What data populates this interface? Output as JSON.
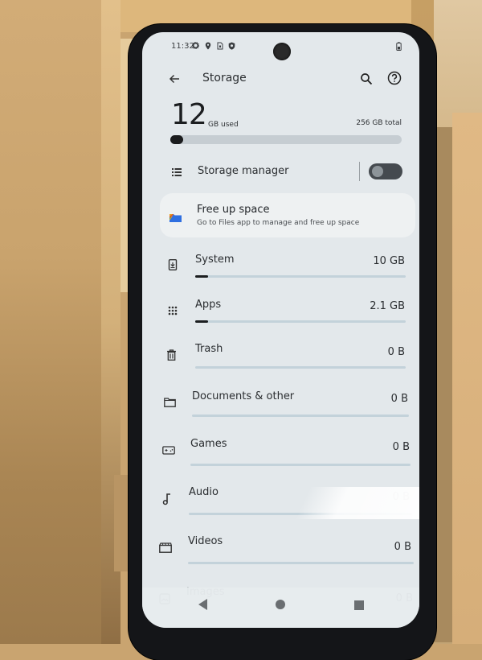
{
  "status_bar": {
    "time": "11:32",
    "icons": [
      "gear-icon",
      "location-icon",
      "sim-icon",
      "shield-icon"
    ],
    "battery_icon": "battery-icon"
  },
  "app_bar": {
    "title": "Storage",
    "back_icon": "arrow-left-icon",
    "search_icon": "search-icon",
    "help_icon": "help-circle-icon"
  },
  "summary": {
    "used_value": "12",
    "used_label": "GB used",
    "total_label": "256 GB total",
    "used_fraction": 0.047
  },
  "storage_manager": {
    "label": "Storage manager",
    "enabled": false
  },
  "free_up_space": {
    "title": "Free up space",
    "subtitle": "Go to Files app to manage and free up space"
  },
  "categories": [
    {
      "label": "System",
      "value": "10 GB",
      "icon": "system-update-icon",
      "fraction": 0.04
    },
    {
      "label": "Apps",
      "value": "2.1 GB",
      "icon": "apps-grid-icon",
      "fraction": 0.008
    },
    {
      "label": "Trash",
      "value": "0 B",
      "icon": "trash-icon",
      "fraction": 0
    },
    {
      "label": "Documents & other",
      "value": "0 B",
      "icon": "folder-icon",
      "fraction": 0
    },
    {
      "label": "Games",
      "value": "0 B",
      "icon": "gamepad-icon",
      "fraction": 0
    },
    {
      "label": "Audio",
      "value": "0 B",
      "icon": "music-note-icon",
      "fraction": 0
    },
    {
      "label": "Videos",
      "value": "0 B",
      "icon": "clapperboard-icon",
      "fraction": 0
    },
    {
      "label": "Images",
      "value": "0 B",
      "icon": "image-icon",
      "fraction": 0
    }
  ],
  "nav_bar": {
    "back": "nav-back-icon",
    "home": "nav-home-icon",
    "recents": "nav-recents-icon"
  }
}
